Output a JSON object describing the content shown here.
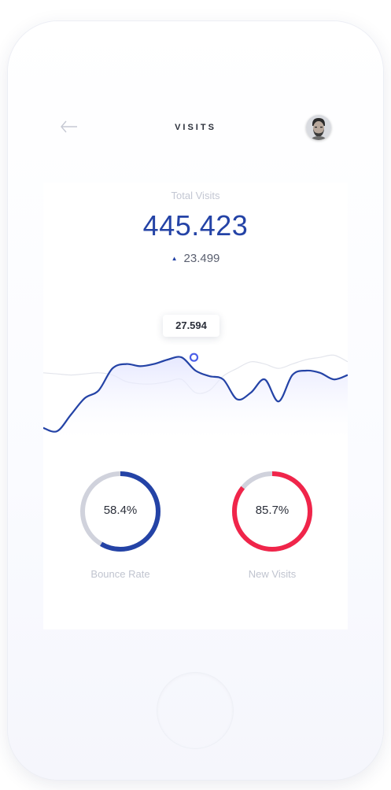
{
  "header": {
    "title": "VISITS",
    "back_icon": "arrow-left-icon",
    "avatar_icon": "user-avatar"
  },
  "summary": {
    "label": "Total Visits",
    "value": "445.423",
    "delta_icon": "triangle-up-icon",
    "delta": "23.499"
  },
  "chart": {
    "tooltip": "27.594",
    "accent": "#2443a6",
    "highlight": "#4b5ee8"
  },
  "chart_data": {
    "type": "line",
    "title": "",
    "xlabel": "",
    "ylabel": "",
    "grid": false,
    "legend": "none",
    "ylim": [
      0,
      100
    ],
    "x": [
      0,
      1,
      2,
      3,
      4,
      5,
      6,
      7,
      8,
      9,
      10,
      11,
      12,
      13,
      14,
      15,
      16,
      17,
      18,
      19,
      20,
      21,
      22
    ],
    "series": [
      {
        "values": [
          8,
          5,
          20,
          35,
          42,
          62,
          66,
          64,
          66,
          70,
          72,
          60,
          55,
          52,
          34,
          40,
          52,
          32,
          56,
          60,
          58,
          52,
          56
        ],
        "color": "#2443a6",
        "highlight_index": 11,
        "highlight_value": 27.594
      },
      {
        "values": [
          58,
          57,
          56,
          57,
          58,
          56,
          50,
          48,
          48,
          50,
          52,
          40,
          42,
          55,
          62,
          68,
          66,
          62,
          66,
          70,
          72,
          74,
          68
        ],
        "color": "#e3e5ec"
      }
    ]
  },
  "stats": [
    {
      "value": "58.4%",
      "label": "Bounce Rate",
      "percent": 58.4,
      "color": "#2443a6",
      "track": "#d0d2dc"
    },
    {
      "value": "85.7%",
      "label": "New Visits",
      "percent": 85.7,
      "color": "#f0254a",
      "track": "#d0d2dc"
    }
  ]
}
